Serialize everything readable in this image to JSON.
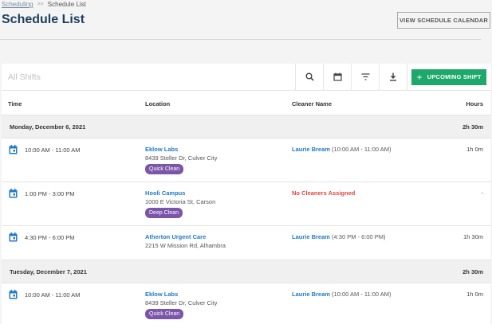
{
  "breadcrumb": {
    "parent": "Scheduling",
    "separator": ">>",
    "current": "Schedule List"
  },
  "page_title": "Schedule List",
  "view_calendar_label": "VIEW SCHEDULE CALENDAR",
  "toolbar": {
    "search_placeholder": "All Shifts",
    "icons": [
      "search-icon",
      "calendar-icon",
      "filter-icon",
      "download-icon"
    ],
    "upcoming_label": "UPCOMING SHIFT"
  },
  "columns": {
    "time": "Time",
    "location": "Location",
    "cleaner": "Cleaner Name",
    "hours": "Hours"
  },
  "colors": {
    "accent_green": "#1ea86b",
    "link_blue": "#1f79c8",
    "tag_purple": "#7b55a8",
    "alert_red": "#e0463f",
    "title_navy": "#1d3f5e"
  },
  "days": [
    {
      "date": "Monday, December 6, 2021",
      "total": "2h 30m",
      "shifts": [
        {
          "time": "10:00 AM - 11:00 AM",
          "location": "Eklow Labs",
          "address": "8439 Steller Dr, Culver City",
          "tag": "Quick Clean",
          "cleaner": "Laurie Bream",
          "cleaner_time": "(10:00 AM - 11:00 AM)",
          "hours": "1h 0m"
        },
        {
          "time": "1:00 PM - 3:00 PM",
          "location": "Hooli Campus",
          "address": "1000 E Victoria St, Carson",
          "tag": "Deep Clean",
          "cleaner": "No Cleaners Assigned",
          "hours": "-"
        },
        {
          "time": "4:30 PM - 6:00 PM",
          "location": "Atherton Urgent Care",
          "address": "2215 W Mission Rd, Alhambra",
          "cleaner": "Laurie Bream",
          "cleaner_time": "(4:30 PM - 6:00 PM)",
          "hours": "1h 30m"
        }
      ]
    },
    {
      "date": "Tuesday, December 7, 2021",
      "total": "2h 30m",
      "shifts": [
        {
          "time": "10:00 AM - 11:00 AM",
          "location": "Eklow Labs",
          "address": "8439 Steller Dr, Culver City",
          "tag": "Quick Clean",
          "cleaner": "Laurie Bream",
          "cleaner_time": "(10:00 AM - 11:00 AM)",
          "hours": "1h 0m"
        }
      ]
    }
  ]
}
